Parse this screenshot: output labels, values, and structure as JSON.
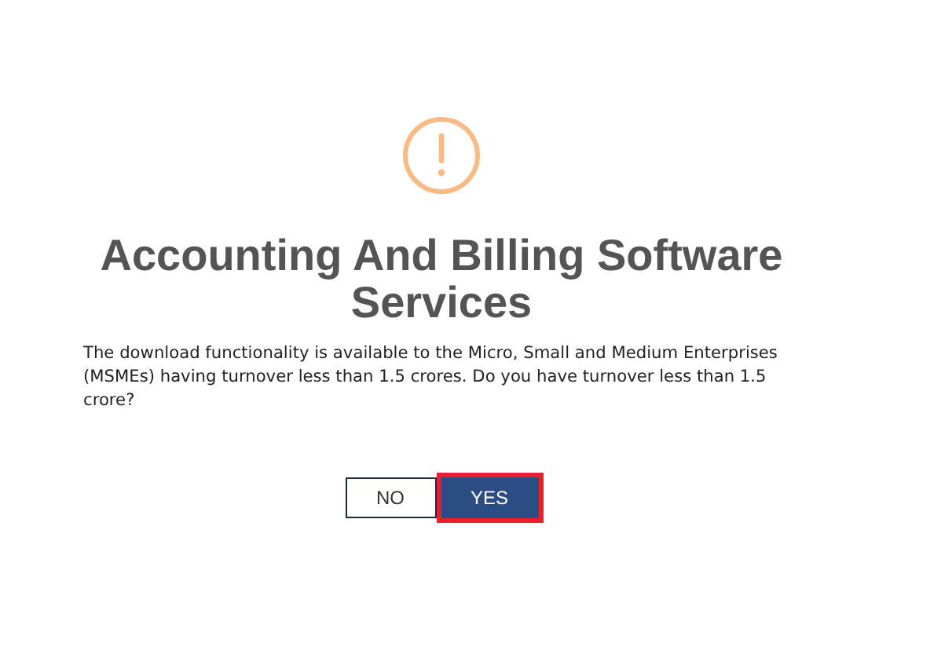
{
  "dialog": {
    "title": "Accounting And Billing Software Services",
    "message": "The download functionality is available to the Micro, Small and Medium Enterprises (MSMEs) having turnover less than 1.5 crores. Do you have turnover less than 1.5 crore?",
    "buttons": [
      {
        "label": "NO",
        "kind": "secondary",
        "highlighted": false
      },
      {
        "label": "YES",
        "kind": "primary",
        "highlighted": true
      }
    ]
  }
}
